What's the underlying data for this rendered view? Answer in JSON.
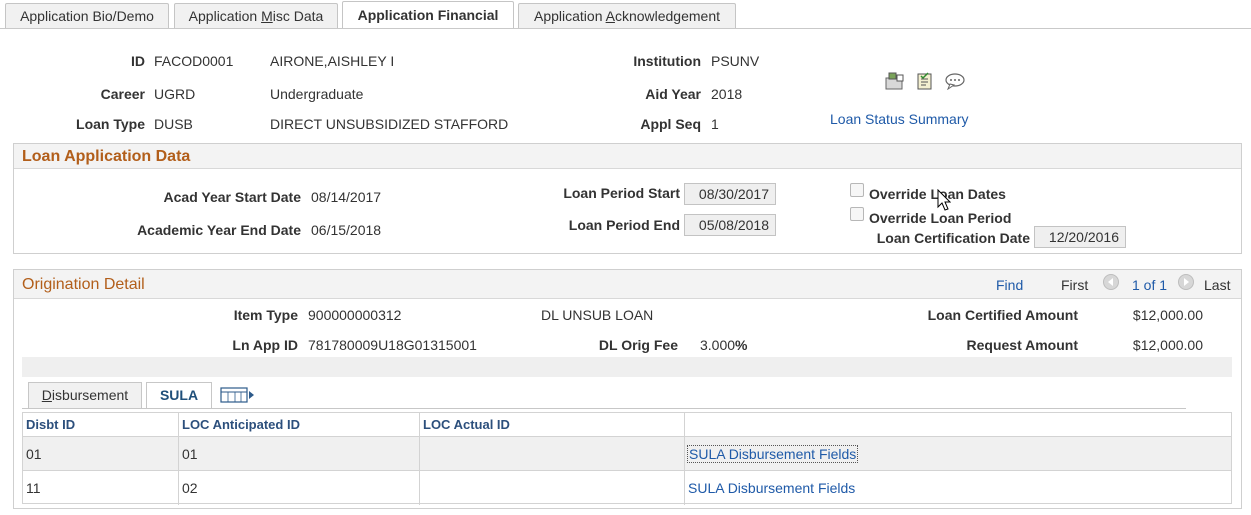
{
  "tabs": {
    "bio_demo": "Application Bio/Demo",
    "misc_pre": "Application ",
    "misc_ul": "M",
    "misc_post": "isc Data",
    "financial": "Application Financial",
    "ack_pre": "Application ",
    "ack_ul": "A",
    "ack_post": "cknowledgement"
  },
  "header": {
    "id_label": "ID",
    "id_value": "FACOD0001",
    "name": "AIRONE,AISHLEY I",
    "career_label": "Career",
    "career_value": "UGRD",
    "career_desc": "Undergraduate",
    "loan_type_label": "Loan Type",
    "loan_type_value": "DUSB",
    "loan_type_desc": "DIRECT UNSUBSIDIZED STAFFORD",
    "institution_label": "Institution",
    "institution_value": "PSUNV",
    "aid_year_label": "Aid Year",
    "aid_year_value": "2018",
    "appl_seq_label": "Appl Seq",
    "appl_seq_value": "1",
    "loan_status_link": "Loan Status Summary"
  },
  "loan_app": {
    "title": "Loan Application Data",
    "acad_start_label": "Acad Year Start Date",
    "acad_start_value": "08/14/2017",
    "acad_end_label": "Academic Year End Date",
    "acad_end_value": "06/15/2018",
    "period_start_label": "Loan Period Start",
    "period_start_value": "08/30/2017",
    "period_end_label": "Loan Period End",
    "period_end_value": "05/08/2018",
    "override_dates_label": "Override Loan Dates",
    "override_period_label": "Override Loan Period",
    "cert_date_label": "Loan Certification Date",
    "cert_date_value": "12/20/2016"
  },
  "origination": {
    "title": "Origination Detail",
    "find": "Find",
    "first": "First",
    "pager": "1 of 1",
    "last": "Last",
    "item_type_label": "Item Type",
    "item_type_value": "900000000312",
    "item_type_desc": "DL UNSUB LOAN",
    "ln_app_id_label": "Ln App ID",
    "ln_app_id_value": "781780009U18G01315001",
    "orig_fee_label": "DL Orig Fee",
    "orig_fee_value": "3.000",
    "orig_fee_unit": "%",
    "cert_amount_label": "Loan Certified Amount",
    "cert_amount_value": "$12,000.00",
    "request_amount_label": "Request Amount",
    "request_amount_value": "$12,000.00"
  },
  "subtabs": {
    "disb_ul": "D",
    "disb_rest": "isbursement",
    "sula": "SULA"
  },
  "grid": {
    "columns": [
      "Disbt ID",
      "LOC Anticipated ID",
      "LOC Actual ID"
    ],
    "rows": [
      {
        "disbt_id": "01",
        "loc_anticipated": "01",
        "loc_actual": "",
        "link": "SULA Disbursement Fields"
      },
      {
        "disbt_id": "11",
        "loc_anticipated": "02",
        "loc_actual": "",
        "link": "SULA Disbursement Fields"
      }
    ]
  },
  "colors": {
    "accent_title": "#b25e1a",
    "link": "#1f5aa8",
    "header_text": "#2c4f7c"
  }
}
